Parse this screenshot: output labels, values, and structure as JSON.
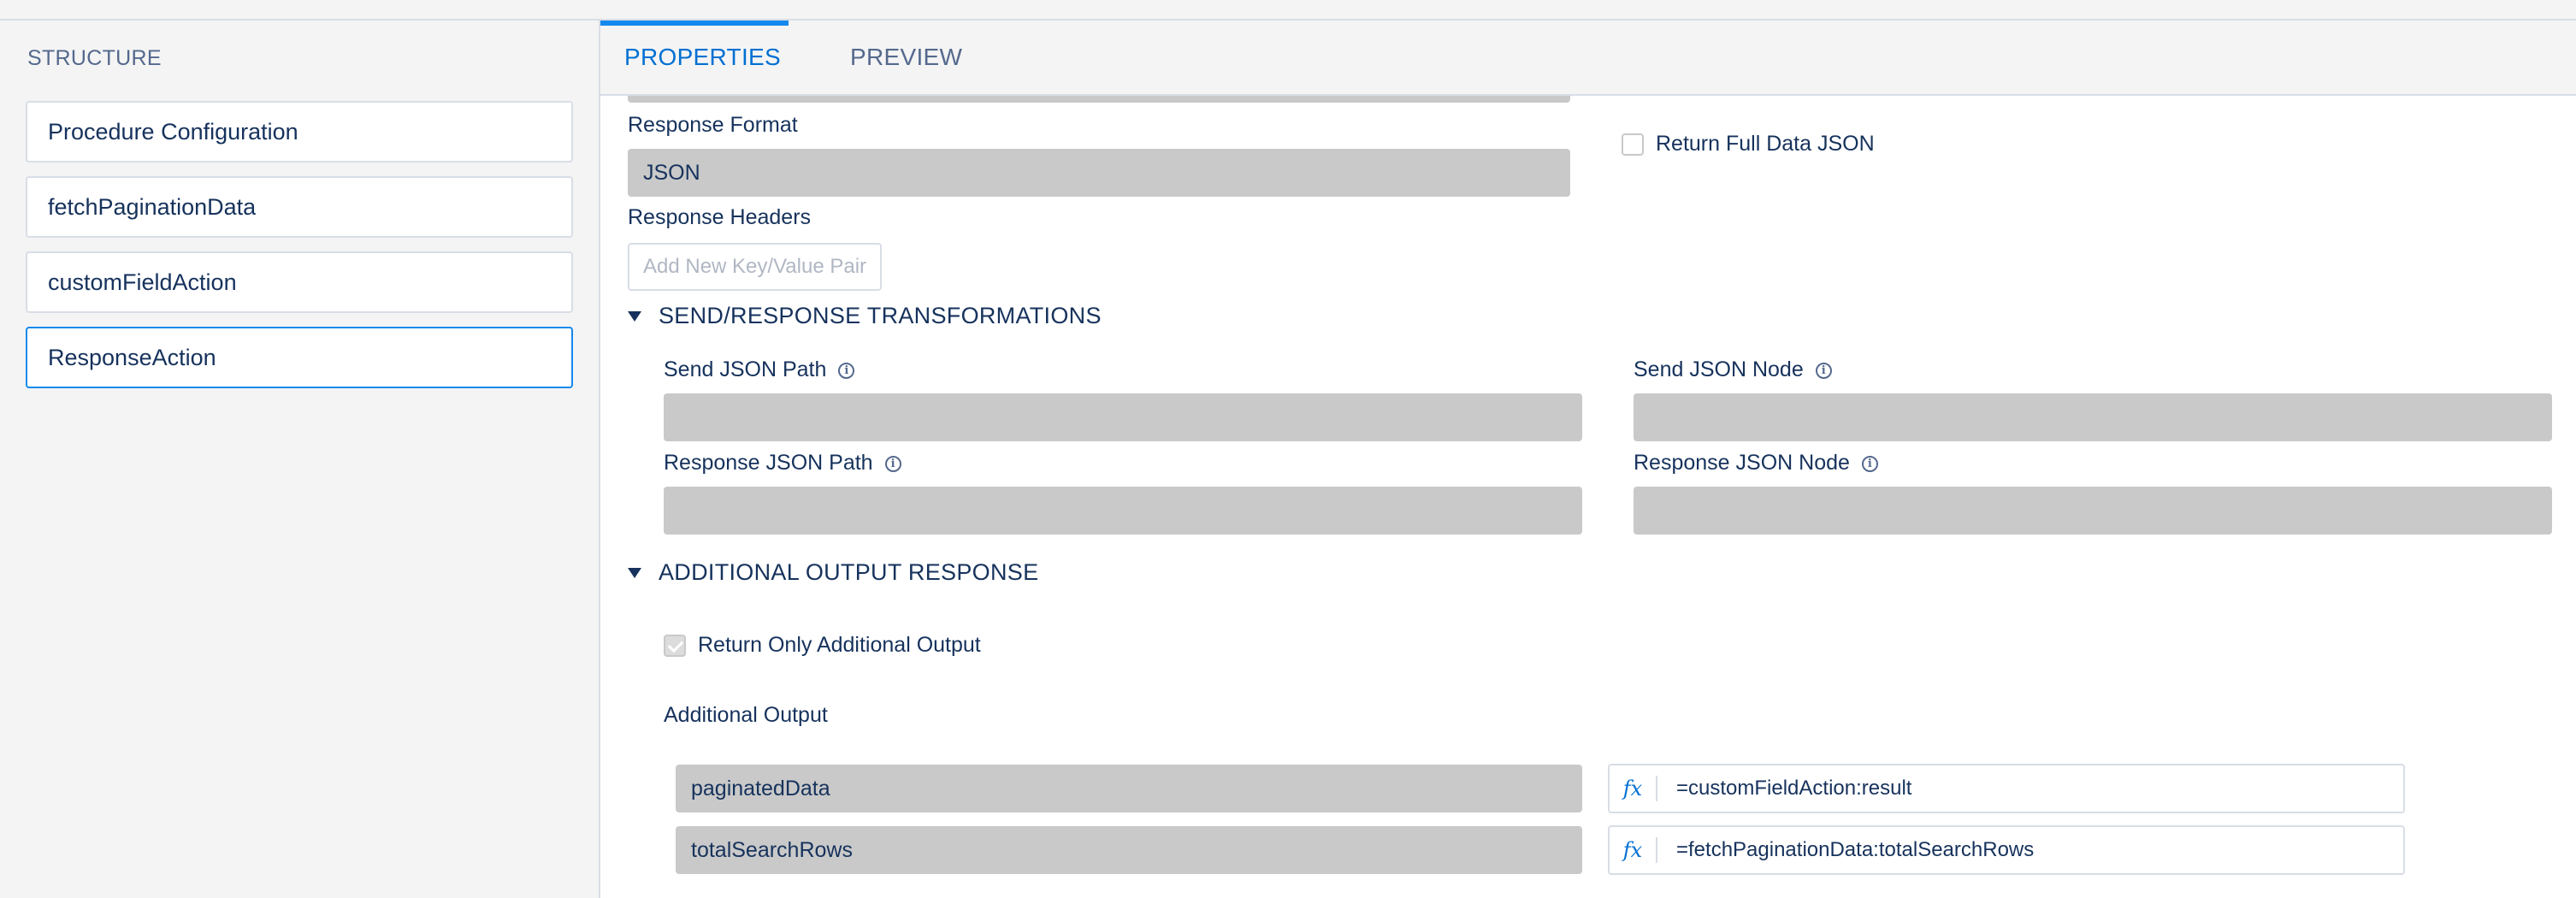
{
  "structure": {
    "title": "STRUCTURE",
    "items": [
      {
        "label": "Procedure Configuration"
      },
      {
        "label": "fetchPaginationData"
      },
      {
        "label": "customFieldAction"
      },
      {
        "label": "ResponseAction"
      }
    ]
  },
  "tabs": [
    {
      "label": "PROPERTIES",
      "active": true
    },
    {
      "label": "PREVIEW",
      "active": false
    }
  ],
  "properties": {
    "response_format_label": "Response Format",
    "response_format_value": "JSON",
    "return_full_data_label": "Return Full Data JSON",
    "response_headers_label": "Response Headers",
    "add_kv_placeholder": "Add New Key/Value Pair",
    "send_response_section": "SEND/RESPONSE TRANSFORMATIONS",
    "send_json_path_label": "Send JSON Path",
    "send_json_node_label": "Send JSON Node",
    "response_json_path_label": "Response JSON Path",
    "response_json_node_label": "Response JSON Node",
    "additional_output_section": "ADDITIONAL OUTPUT RESPONSE",
    "return_only_additional_label": "Return Only Additional Output",
    "additional_output_label": "Additional Output",
    "outputs": [
      {
        "key": "paginatedData",
        "fx": "fx",
        "value": "=customFieldAction:result"
      },
      {
        "key": "totalSearchRows",
        "fx": "fx",
        "value": "=fetchPaginationData:totalSearchRows"
      }
    ]
  },
  "info_icon_glyph": "i"
}
